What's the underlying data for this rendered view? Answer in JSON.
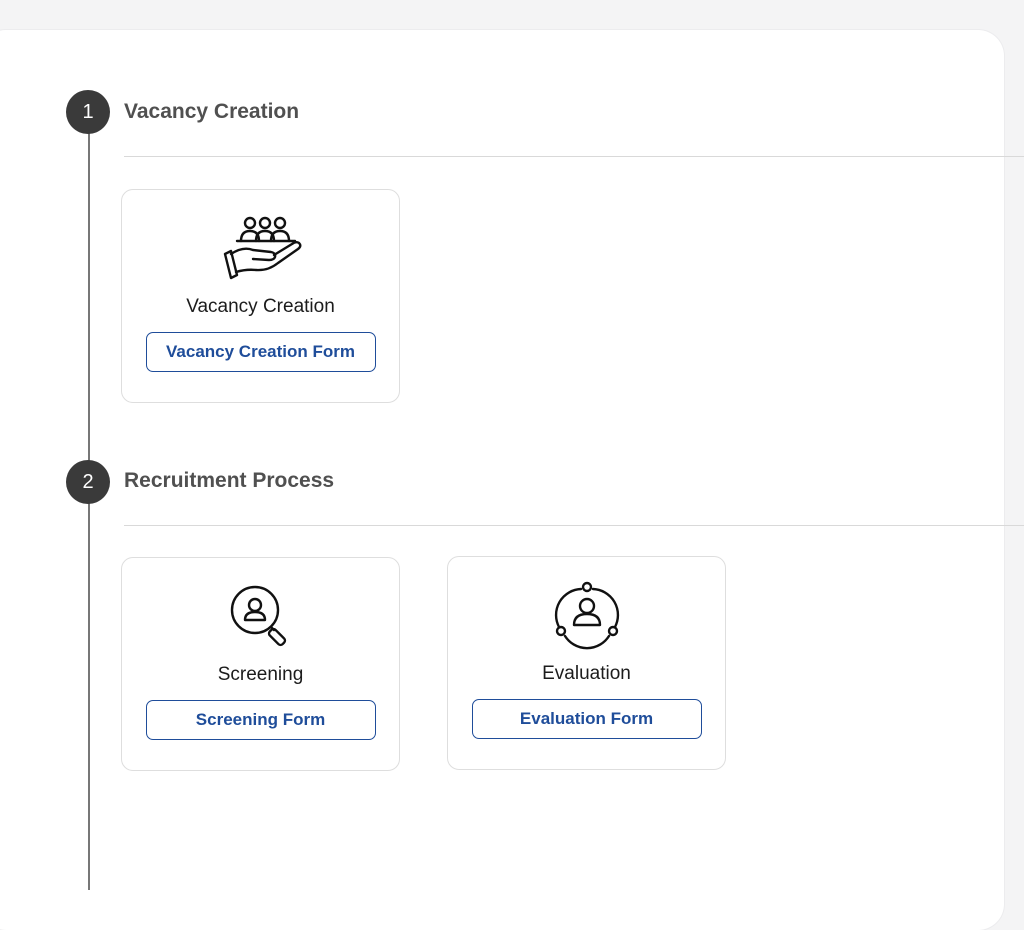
{
  "steps": [
    {
      "number": "1",
      "title": "Vacancy Creation",
      "cards": [
        {
          "title": "Vacancy Creation",
          "button": "Vacancy Creation Form",
          "icon": "people-hand-icon"
        }
      ]
    },
    {
      "number": "2",
      "title": "Recruitment Process",
      "cards": [
        {
          "title": "Screening",
          "button": "Screening Form",
          "icon": "magnifier-user-icon"
        },
        {
          "title": "Evaluation",
          "button": "Evaluation Form",
          "icon": "user-circle-nodes-icon"
        }
      ]
    }
  ],
  "colors": {
    "accent": "#1f4d9a",
    "step_circle": "#3a3a3a",
    "heading": "#505050"
  }
}
